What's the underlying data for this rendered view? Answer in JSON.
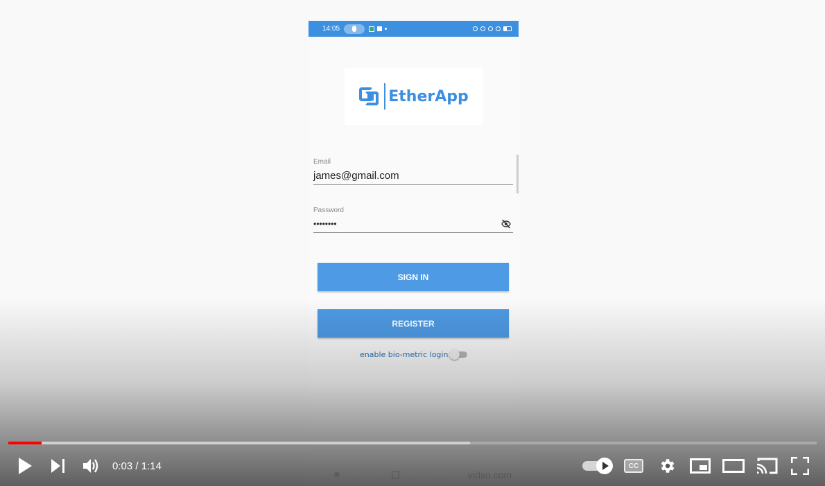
{
  "phone": {
    "status": {
      "time": "14:05"
    },
    "logo_text": "EtherApp",
    "email": {
      "label": "Email",
      "value": "james@gmail.com"
    },
    "password": {
      "label": "Password",
      "value": "••••••••"
    },
    "sign_in_label": "SIGN IN",
    "register_label": "REGISTER",
    "biometric_label": "enable bio-metric login",
    "nav": {
      "menu": "≡",
      "home": "▢"
    },
    "watermark": "vidso.com"
  },
  "player": {
    "time_current": "0:03",
    "time_separator": " / ",
    "time_total": "1:14",
    "progress_fraction": 0.041,
    "buffered_fraction": 0.571,
    "played_color": "#ff0000",
    "icons": {
      "play": "play-icon",
      "next": "next-icon",
      "volume": "volume-icon",
      "autoplay": "autoplay-toggle",
      "subtitles": "subtitles-icon",
      "settings": "settings-icon",
      "miniplayer": "miniplayer-icon",
      "theater": "theater-icon",
      "cast": "cast-icon",
      "fullscreen": "fullscreen-icon"
    }
  },
  "colors": {
    "accent": "#3d8fe0",
    "button": "#4e9ae4",
    "link": "#2a73b8"
  }
}
